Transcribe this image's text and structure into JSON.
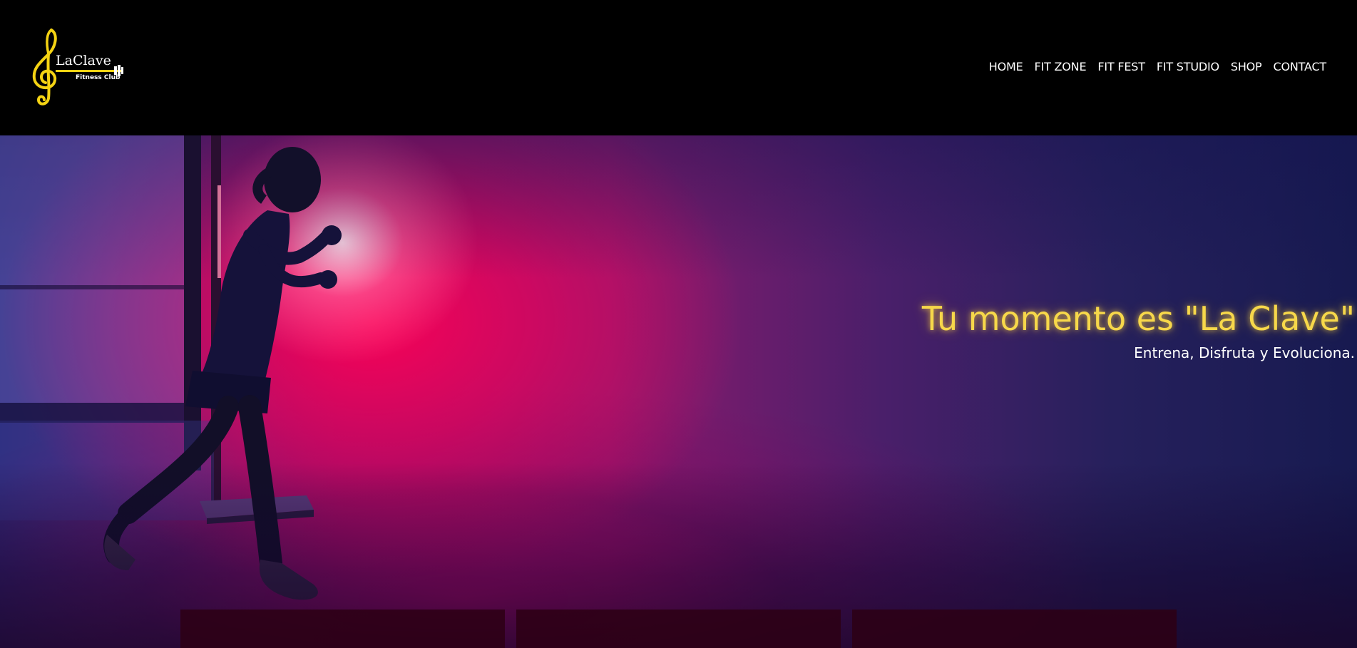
{
  "brand": {
    "name": "LaClave",
    "tagline": "Fitness Club",
    "accent_color": "#f4d313"
  },
  "nav": {
    "items": [
      {
        "label": "HOME"
      },
      {
        "label": "FIT ZONE"
      },
      {
        "label": "FIT FEST"
      },
      {
        "label": "FIT STUDIO"
      },
      {
        "label": "SHOP"
      },
      {
        "label": "CONTACT"
      }
    ]
  },
  "hero": {
    "title": "Tu momento es \"La Clave\"",
    "subtitle": "Entrena, Disfruta y Evoluciona.",
    "title_color": "#f7d84a"
  },
  "cards": {
    "count_visible": 3,
    "background": "#2d0014"
  }
}
